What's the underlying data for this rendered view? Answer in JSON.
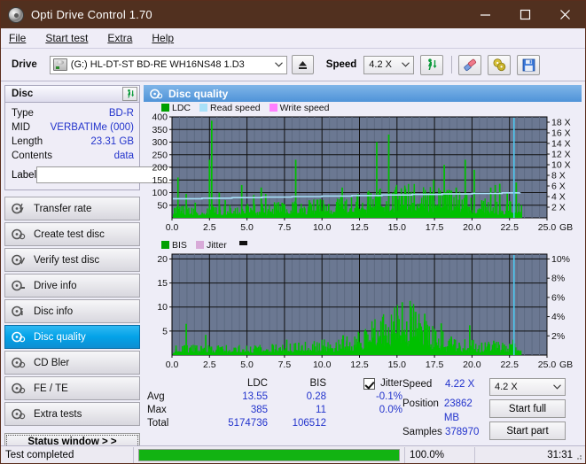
{
  "window": {
    "title": "Opti Drive Control 1.70",
    "icon": "disc-icon",
    "minimize": "–",
    "maximize": "□",
    "close": "×"
  },
  "menubar": [
    {
      "label": "File",
      "accel": "F"
    },
    {
      "label": "Start test",
      "accel": "S"
    },
    {
      "label": "Extra",
      "accel": "x"
    },
    {
      "label": "Help",
      "accel": "H"
    }
  ],
  "drivebar": {
    "drive_label": "Drive",
    "drive_value": "(G:)  HL-DT-ST BD-RE  WH16NS48 1.D3",
    "eject_icon": "eject-icon",
    "speed_label": "Speed",
    "speed_value": "4.2 X",
    "refresh_icon": "refresh-drive-icon",
    "erase_icon": "eraser-icon",
    "disc-tools_icon": "disc-tools-icon",
    "save_icon": "save-icon"
  },
  "disc_panel": {
    "title": "Disc",
    "refresh_icon": "refresh-icon",
    "rows": [
      {
        "key": "Type",
        "value": "BD-R"
      },
      {
        "key": "MID",
        "value": "VERBATIMe (000)"
      },
      {
        "key": "Length",
        "value": "23.31 GB"
      },
      {
        "key": "Contents",
        "value": "data"
      }
    ],
    "label_key": "Label",
    "label_value": "",
    "label_placeholder": "",
    "label_button_icon": "disc-label-icon"
  },
  "nav": {
    "items": [
      {
        "label": "Transfer rate",
        "icon": "transfer-rate-icon",
        "active": false
      },
      {
        "label": "Create test disc",
        "icon": "create-test-disc-icon",
        "active": false
      },
      {
        "label": "Verify test disc",
        "icon": "verify-test-disc-icon",
        "active": false
      },
      {
        "label": "Drive info",
        "icon": "drive-info-icon",
        "active": false
      },
      {
        "label": "Disc info",
        "icon": "disc-info-icon",
        "active": false
      },
      {
        "label": "Disc quality",
        "icon": "disc-quality-icon",
        "active": true
      },
      {
        "label": "CD Bler",
        "icon": "cd-bler-icon",
        "active": false
      },
      {
        "label": "FE / TE",
        "icon": "fe-te-icon",
        "active": false
      },
      {
        "label": "Extra tests",
        "icon": "extra-tests-icon",
        "active": false
      }
    ],
    "status_button": "Status window > >"
  },
  "main": {
    "header": "Disc quality",
    "header_icon": "disc-quality-icon"
  },
  "stats": {
    "headers": [
      "",
      "LDC",
      "BIS",
      "Jitter"
    ],
    "jitter_checked": true,
    "rows": [
      {
        "label": "Avg",
        "ldc": "13.55",
        "bis": "0.28",
        "jitter": "-0.1%"
      },
      {
        "label": "Max",
        "ldc": "385",
        "bis": "11",
        "jitter": "0.0%"
      },
      {
        "label": "Total",
        "ldc": "5174736",
        "bis": "106512",
        "jitter": ""
      }
    ],
    "speed_label": "Speed",
    "speed_value": "4.22 X",
    "position_label": "Position",
    "position_value": "23862 MB",
    "samples_label": "Samples",
    "samples_value": "378970",
    "speed_select": "4.2 X",
    "start_full": "Start full",
    "start_part": "Start part"
  },
  "statusbar": {
    "message": "Test completed",
    "percent_label": "100.0%",
    "percent_value": 100,
    "elapsed": "31:31"
  },
  "colors": {
    "title_bar": "#51301f",
    "accent": "#03a2e8",
    "ldc": "#00c000",
    "bis": "#00c000",
    "read_speed": "#a8e0f8",
    "write_speed": "#ff80ff",
    "jitter": "#d8aad8",
    "plot_bg": "#6b7892",
    "value_text": "#2233cc",
    "progress": "#12b312"
  },
  "chart_data": [
    {
      "type": "area",
      "name": "disc-quality-ldc",
      "title": "",
      "xlabel": "GB",
      "ylabel": "LDC",
      "xlim": [
        0.0,
        25.0
      ],
      "xticks": [
        "0.0",
        "2.5",
        "5.0",
        "7.5",
        "10.0",
        "12.5",
        "15.0",
        "17.5",
        "20.0",
        "22.5",
        "25.0"
      ],
      "x_unit": "GB",
      "ylim": [
        0,
        400
      ],
      "yticks": [
        50,
        100,
        150,
        200,
        250,
        300,
        350,
        400
      ],
      "y2lim": [
        0,
        19
      ],
      "y2ticks": [
        "2 X",
        "4 X",
        "6 X",
        "8 X",
        "10 X",
        "12 X",
        "14 X",
        "16 X",
        "18 X"
      ],
      "grid": true,
      "legend": [
        {
          "label": "LDC",
          "color": "#00a000"
        },
        {
          "label": "Read speed",
          "color": "#a8e0f8"
        },
        {
          "label": "Write speed",
          "color": "#ff80ff"
        }
      ],
      "data_end_x": 23.31,
      "cursor_x": 22.8,
      "series": [
        {
          "name": "LDC",
          "color": "#00c000",
          "envelope_x": [
            0.0,
            1.0,
            2.0,
            3.0,
            4.0,
            5.0,
            6.0,
            7.0,
            8.0,
            9.0,
            10.0,
            11.0,
            12.0,
            13.0,
            14.0,
            15.0,
            16.0,
            17.0,
            18.0,
            19.0,
            20.0,
            21.0,
            22.0,
            23.0,
            23.31
          ],
          "envelope_y": [
            12,
            14,
            13,
            15,
            14,
            16,
            16,
            18,
            19,
            20,
            22,
            24,
            26,
            30,
            34,
            38,
            40,
            38,
            34,
            30,
            26,
            22,
            20,
            18,
            16
          ],
          "spikes": [
            {
              "x": 0.35,
              "y": 160
            },
            {
              "x": 0.9,
              "y": 95
            },
            {
              "x": 1.5,
              "y": 60
            },
            {
              "x": 2.45,
              "y": 230
            },
            {
              "x": 2.6,
              "y": 385
            },
            {
              "x": 3.1,
              "y": 100
            },
            {
              "x": 3.5,
              "y": 70
            },
            {
              "x": 4.6,
              "y": 130
            },
            {
              "x": 5.4,
              "y": 90
            },
            {
              "x": 5.9,
              "y": 120
            },
            {
              "x": 6.2,
              "y": 95
            },
            {
              "x": 7.3,
              "y": 60
            },
            {
              "x": 8.2,
              "y": 230
            },
            {
              "x": 9.1,
              "y": 70
            },
            {
              "x": 10.4,
              "y": 55
            },
            {
              "x": 11.3,
              "y": 120
            },
            {
              "x": 12.3,
              "y": 90
            },
            {
              "x": 13.0,
              "y": 60
            },
            {
              "x": 13.6,
              "y": 300
            },
            {
              "x": 14.4,
              "y": 330
            },
            {
              "x": 15.1,
              "y": 90
            },
            {
              "x": 16.1,
              "y": 110
            },
            {
              "x": 17.4,
              "y": 150
            },
            {
              "x": 18.1,
              "y": 210
            },
            {
              "x": 18.9,
              "y": 120
            },
            {
              "x": 19.5,
              "y": 230
            },
            {
              "x": 20.1,
              "y": 190
            },
            {
              "x": 20.6,
              "y": 70
            },
            {
              "x": 21.2,
              "y": 120
            },
            {
              "x": 21.5,
              "y": 130
            },
            {
              "x": 21.8,
              "y": 135
            },
            {
              "x": 22.3,
              "y": 100
            },
            {
              "x": 22.9,
              "y": 140
            }
          ]
        },
        {
          "name": "Read speed",
          "color": "#a8e0f8",
          "axis": "right",
          "x": [
            0.0,
            2.0,
            4.0,
            6.0,
            8.0,
            10.0,
            12.0,
            14.0,
            16.0,
            18.0,
            20.0,
            22.0,
            23.2
          ],
          "y": [
            3.6,
            3.7,
            3.8,
            3.9,
            4.0,
            4.1,
            4.2,
            4.3,
            4.4,
            4.5,
            4.6,
            4.7,
            4.75
          ]
        }
      ]
    },
    {
      "type": "area",
      "name": "disc-quality-bis",
      "title": "",
      "xlabel": "GB",
      "ylabel": "BIS",
      "xlim": [
        0.0,
        25.0
      ],
      "xticks": [
        "0.0",
        "2.5",
        "5.0",
        "7.5",
        "10.0",
        "12.5",
        "15.0",
        "17.5",
        "20.0",
        "22.5",
        "25.0"
      ],
      "x_unit": "GB",
      "ylim": [
        0,
        21
      ],
      "yticks": [
        5,
        10,
        15,
        20
      ],
      "y2lim": [
        0,
        10.5
      ],
      "y2ticks": [
        "2%",
        "4%",
        "6%",
        "8%",
        "10%"
      ],
      "grid": true,
      "legend": [
        {
          "label": "BIS",
          "color": "#00a000"
        },
        {
          "label": "Jitter",
          "color": "#d8aad8"
        }
      ],
      "data_end_x": 23.31,
      "cursor_x": 22.8,
      "series": [
        {
          "name": "BIS",
          "color": "#00c000",
          "envelope_x": [
            0.0,
            1.0,
            2.0,
            3.0,
            4.0,
            5.0,
            6.0,
            7.0,
            8.0,
            9.0,
            10.0,
            11.0,
            12.0,
            13.0,
            14.0,
            15.0,
            16.0,
            17.0,
            18.0,
            19.0,
            20.0,
            21.0,
            22.0,
            23.0,
            23.31
          ],
          "envelope_y": [
            0.6,
            0.6,
            0.6,
            0.6,
            0.6,
            0.6,
            0.7,
            0.7,
            0.7,
            0.8,
            0.9,
            1.1,
            1.4,
            2.0,
            2.8,
            3.4,
            3.2,
            2.4,
            1.4,
            1.0,
            0.9,
            0.8,
            0.8,
            0.7,
            0.7
          ],
          "spikes": [
            {
              "x": 0.9,
              "y": 6.5
            },
            {
              "x": 1.6,
              "y": 2.0
            },
            {
              "x": 2.2,
              "y": 4.2
            },
            {
              "x": 3.3,
              "y": 1.8
            },
            {
              "x": 4.4,
              "y": 1.6
            },
            {
              "x": 5.6,
              "y": 1.6
            },
            {
              "x": 6.7,
              "y": 2.0
            },
            {
              "x": 7.6,
              "y": 3.2
            },
            {
              "x": 8.4,
              "y": 2.6
            },
            {
              "x": 9.5,
              "y": 1.8
            },
            {
              "x": 10.5,
              "y": 2.2
            },
            {
              "x": 11.6,
              "y": 2.6
            },
            {
              "x": 12.4,
              "y": 4.6
            },
            {
              "x": 12.9,
              "y": 3.6
            },
            {
              "x": 13.4,
              "y": 5.6
            },
            {
              "x": 13.8,
              "y": 4.0
            },
            {
              "x": 14.2,
              "y": 6.4
            },
            {
              "x": 14.6,
              "y": 5.2
            },
            {
              "x": 15.0,
              "y": 8.2
            },
            {
              "x": 15.3,
              "y": 11.0
            },
            {
              "x": 15.6,
              "y": 7.0
            },
            {
              "x": 15.9,
              "y": 6.0
            },
            {
              "x": 16.2,
              "y": 9.0
            },
            {
              "x": 16.5,
              "y": 6.6
            },
            {
              "x": 16.8,
              "y": 8.6
            },
            {
              "x": 17.1,
              "y": 6.0
            },
            {
              "x": 17.5,
              "y": 5.0
            },
            {
              "x": 17.9,
              "y": 6.6
            },
            {
              "x": 18.4,
              "y": 3.0
            },
            {
              "x": 19.1,
              "y": 2.6
            },
            {
              "x": 19.8,
              "y": 6.2
            },
            {
              "x": 20.6,
              "y": 2.6
            },
            {
              "x": 21.4,
              "y": 3.0
            },
            {
              "x": 22.1,
              "y": 2.2
            },
            {
              "x": 22.7,
              "y": 3.2
            }
          ]
        }
      ]
    }
  ]
}
